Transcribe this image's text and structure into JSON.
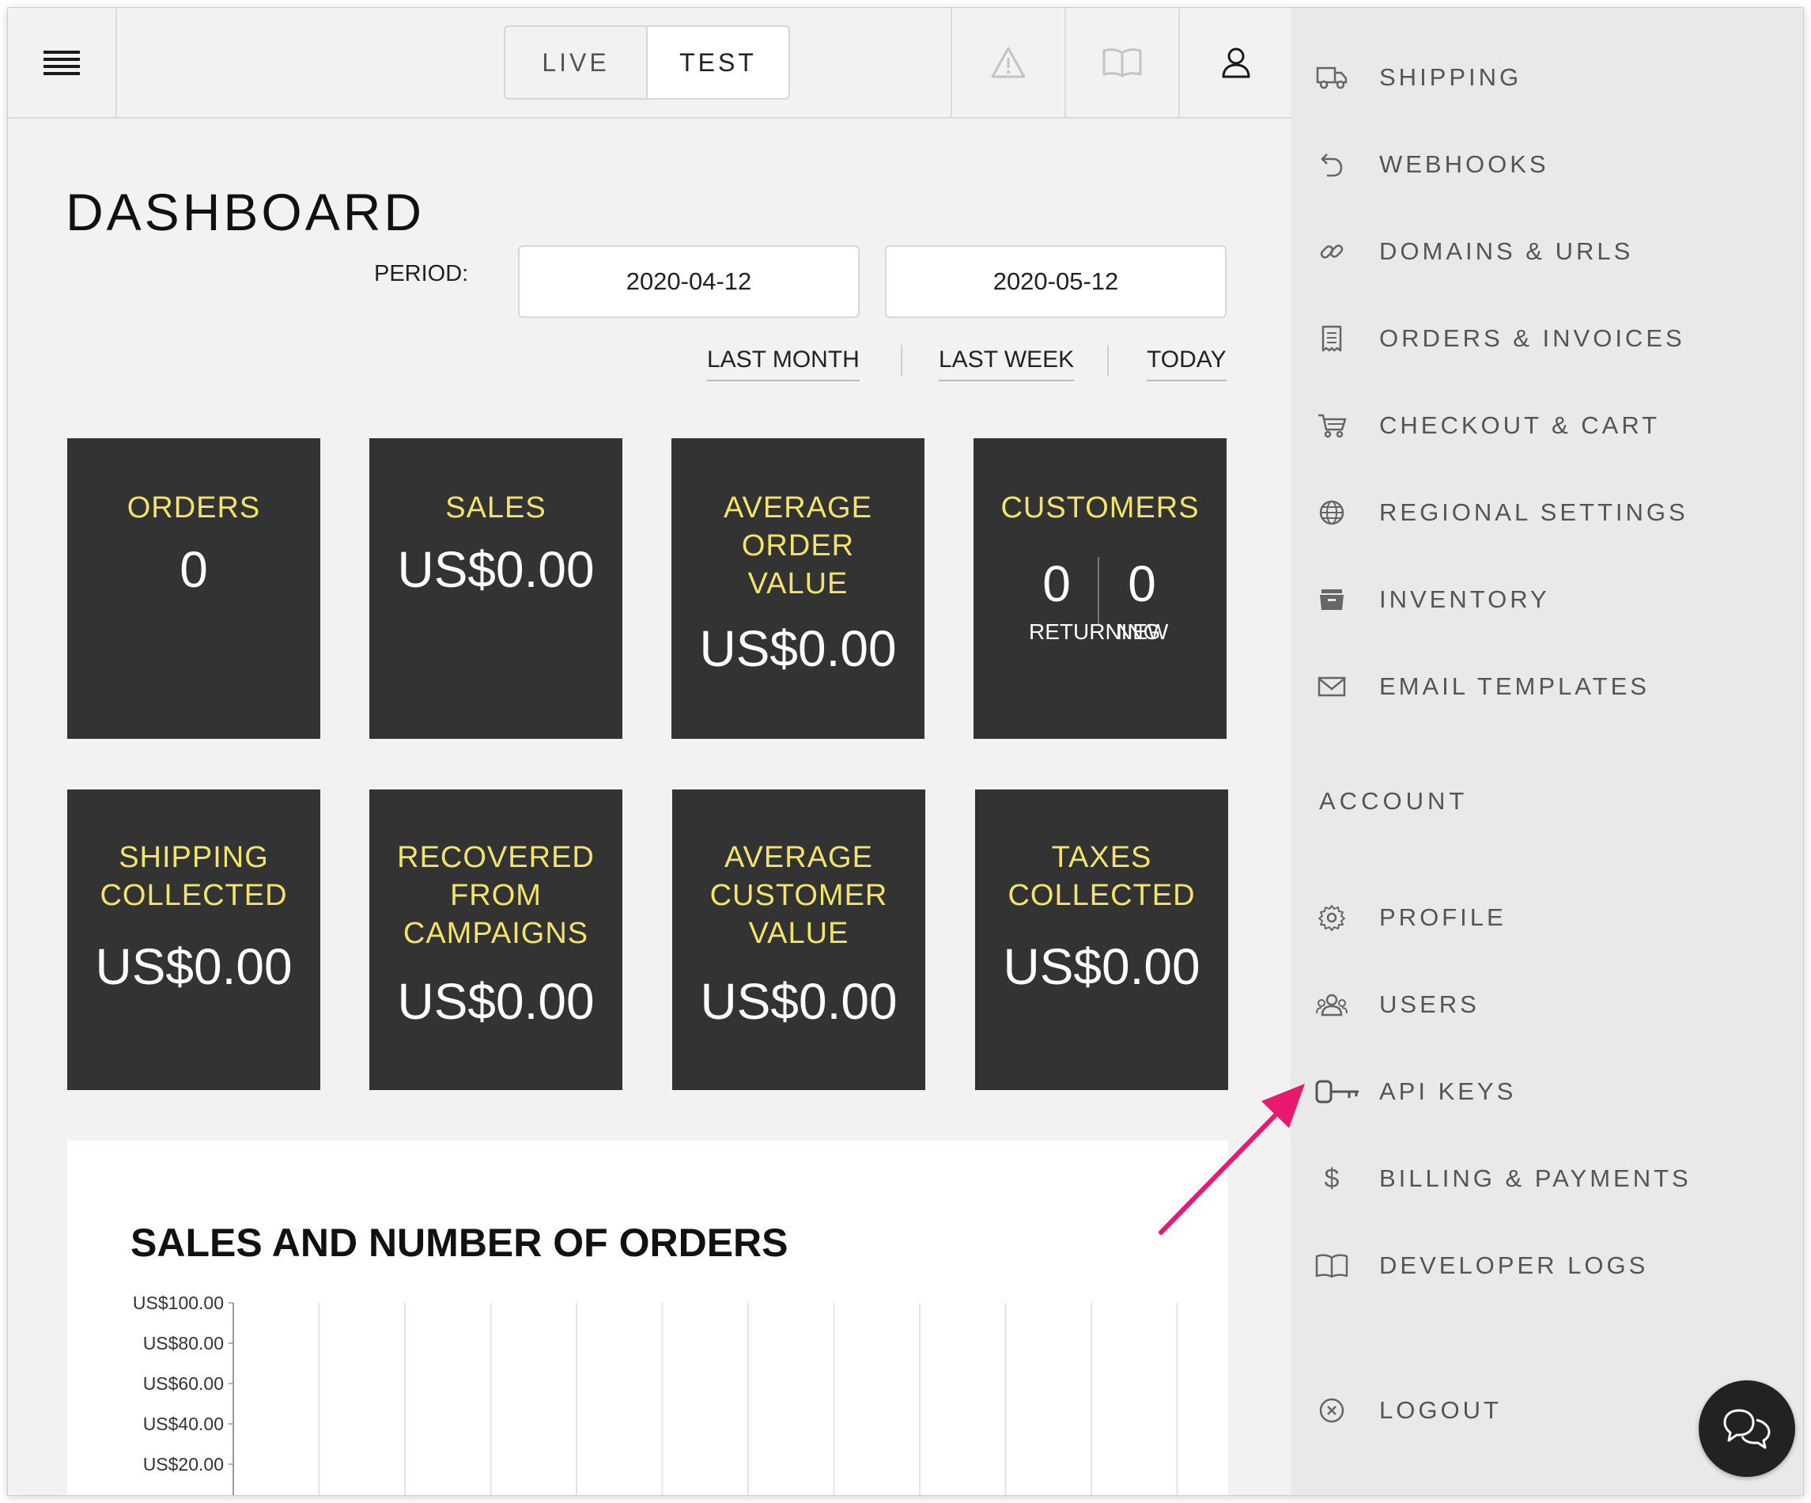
{
  "topbar": {
    "modes": [
      "LIVE",
      "TEST"
    ],
    "active_mode": "TEST",
    "icons": [
      "warning-icon",
      "book-icon",
      "user-icon"
    ]
  },
  "dashboard": {
    "title": "DASHBOARD",
    "period_label": "PERIOD:",
    "date_from": "2020-04-12",
    "date_to": "2020-05-12",
    "quick_ranges": [
      "LAST MONTH",
      "LAST WEEK",
      "TODAY"
    ]
  },
  "tiles": {
    "orders": {
      "label": "ORDERS",
      "value": "0"
    },
    "sales": {
      "label": "SALES",
      "value": "US$0.00"
    },
    "aov": {
      "label_1": "AVERAGE",
      "label_2": "ORDER",
      "label_3": "VALUE",
      "value": "US$0.00"
    },
    "customers": {
      "label": "CUSTOMERS",
      "returning_value": "0",
      "new_value": "0",
      "returning_label": "RETURNING",
      "new_label": "NEW"
    },
    "shipping": {
      "label_1": "SHIPPING",
      "label_2": "COLLECTED",
      "value": "US$0.00"
    },
    "recovered": {
      "label_1": "RECOVERED",
      "label_2": "FROM",
      "label_3": "CAMPAIGNS",
      "value": "US$0.00"
    },
    "acv": {
      "label_1": "AVERAGE",
      "label_2": "CUSTOMER",
      "label_3": "VALUE",
      "value": "US$0.00"
    },
    "taxes": {
      "label_1": "TAXES",
      "label_2": "COLLECTED",
      "value": "US$0.00"
    }
  },
  "chart": {
    "title": "SALES AND NUMBER OF ORDERS"
  },
  "chart_data": {
    "type": "bar",
    "title": "SALES AND NUMBER OF ORDERS",
    "ylabel": "",
    "xlabel": "",
    "y_ticks": [
      "US$100.00",
      "US$80.00",
      "US$60.00",
      "US$40.00",
      "US$20.00"
    ],
    "ylim": [
      0,
      100
    ],
    "grid": "vertical",
    "series": []
  },
  "sidebar": {
    "items": [
      {
        "label": "SHIPPING",
        "icon": "truck-icon"
      },
      {
        "label": "WEBHOOKS",
        "icon": "undo-arrow-icon"
      },
      {
        "label": "DOMAINS & URLS",
        "icon": "link-icon"
      },
      {
        "label": "ORDERS & INVOICES",
        "icon": "receipt-icon"
      },
      {
        "label": "CHECKOUT & CART",
        "icon": "cart-icon"
      },
      {
        "label": "REGIONAL SETTINGS",
        "icon": "globe-icon"
      },
      {
        "label": "INVENTORY",
        "icon": "inventory-box-icon"
      },
      {
        "label": "EMAIL TEMPLATES",
        "icon": "envelope-icon"
      }
    ],
    "account_label": "ACCOUNT",
    "account_items": [
      {
        "label": "PROFILE",
        "icon": "gear-icon"
      },
      {
        "label": "USERS",
        "icon": "users-icon"
      },
      {
        "label": "API KEYS",
        "icon": "key-icon"
      },
      {
        "label": "BILLING & PAYMENTS",
        "icon": "dollar-icon"
      },
      {
        "label": "DEVELOPER LOGS",
        "icon": "book-icon"
      }
    ],
    "logout_label": "LOGOUT",
    "logout_icon": "close-circle-icon"
  },
  "colors": {
    "tile_bg": "#333333",
    "tile_label": "#f2e36a",
    "annotation_arrow": "#e8196e",
    "sidebar_bg": "#e9e9e9"
  }
}
